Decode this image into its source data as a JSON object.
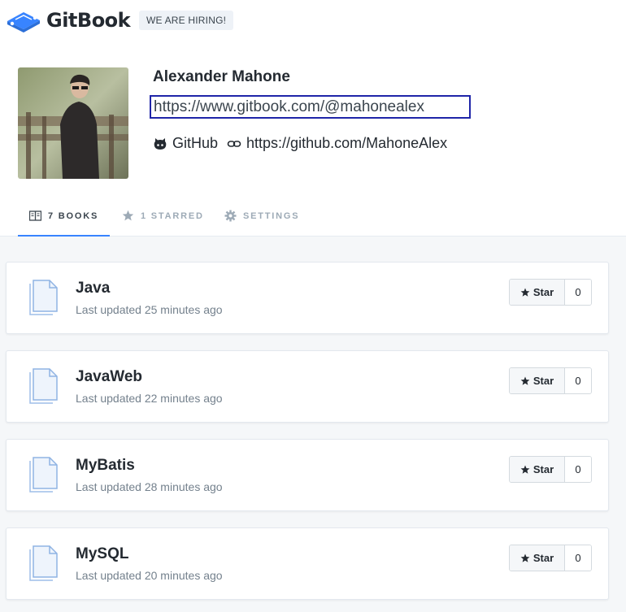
{
  "header": {
    "logo_text": "GitBook",
    "hiring_badge": "WE ARE HIRING!"
  },
  "profile": {
    "name": "Alexander Mahone",
    "url": "https://www.gitbook.com/@mahonealex",
    "github_label": "GitHub",
    "github_url": "https://github.com/MahoneAlex"
  },
  "tabs": [
    {
      "label": "7 BOOKS",
      "icon": "book-open-icon",
      "active": true
    },
    {
      "label": "1 STARRED",
      "icon": "star-icon",
      "active": false
    },
    {
      "label": "SETTINGS",
      "icon": "gear-icon",
      "active": false
    }
  ],
  "books": [
    {
      "title": "Java",
      "updated": "Last updated 25 minutes ago",
      "star_label": "Star",
      "star_count": "0"
    },
    {
      "title": "JavaWeb",
      "updated": "Last updated 22 minutes ago",
      "star_label": "Star",
      "star_count": "0"
    },
    {
      "title": "MyBatis",
      "updated": "Last updated 28 minutes ago",
      "star_label": "Star",
      "star_count": "0"
    },
    {
      "title": "MySQL",
      "updated": "Last updated 20 minutes ago",
      "star_label": "Star",
      "star_count": "0"
    }
  ],
  "colors": {
    "accent": "#3884ff",
    "url_border": "#1f25a8",
    "list_background": "#f5f7f9"
  }
}
